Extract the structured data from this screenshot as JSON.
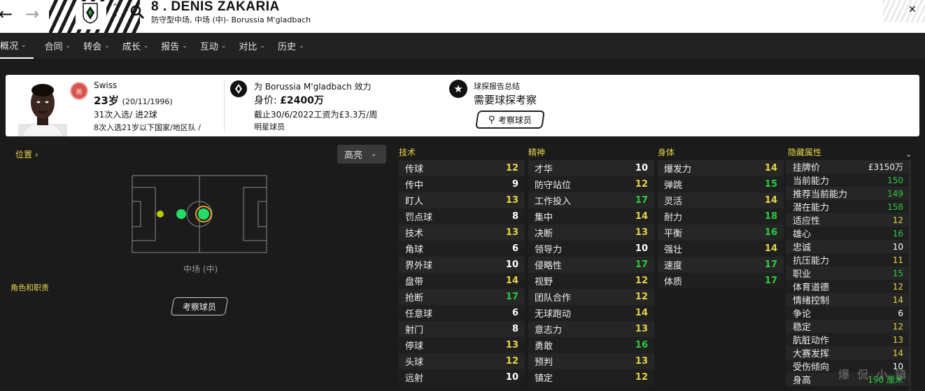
{
  "header": {
    "player_name": "8 . DENIS ZAKARIA",
    "player_sub": "防守型中场, 中场 (中)- Borussia M'gladbach"
  },
  "menu": [
    {
      "label": "概况"
    },
    {
      "label": "合同"
    },
    {
      "label": "转会"
    },
    {
      "label": "成长"
    },
    {
      "label": "报告"
    },
    {
      "label": "互动"
    },
    {
      "label": "对比"
    },
    {
      "label": "历史"
    }
  ],
  "card": {
    "flag_text": "国家...",
    "nationality": "Swiss",
    "age": "23岁",
    "dob": "(20/11/1996)",
    "caps": "31次入选/ 进2球",
    "youth_caps": "8次入选21岁以下国家/地区队 /",
    "club_line": "为 Borussia M'gladbach 效力",
    "value_label": "身价:",
    "value": "£2400万",
    "wage": "截止30/6/2022工资为£3.3万/周",
    "status": "明星球员",
    "report_title": "球探报告总结",
    "report_text": "需要球探考察",
    "scout_button": "考察球员"
  },
  "left": {
    "position_link": "位置",
    "highlight": "高亮",
    "position_label": "中场 (中)",
    "roles_label": "角色和职责",
    "scout_button": "考察球员"
  },
  "colors": {
    "attr_high": "#2ecc40",
    "attr_mid": "#e8d34a",
    "attr_low": "#ffffff",
    "accent": "#e8d34a"
  },
  "technical": {
    "title": "技术",
    "rows": [
      {
        "name": "传球",
        "value": "12"
      },
      {
        "name": "传中",
        "value": "9"
      },
      {
        "name": "盯人",
        "value": "13"
      },
      {
        "name": "罚点球",
        "value": "8"
      },
      {
        "name": "技术",
        "value": "13"
      },
      {
        "name": "角球",
        "value": "6"
      },
      {
        "name": "界外球",
        "value": "10"
      },
      {
        "name": "盘带",
        "value": "14"
      },
      {
        "name": "抢断",
        "value": "17"
      },
      {
        "name": "任意球",
        "value": "6"
      },
      {
        "name": "射门",
        "value": "8"
      },
      {
        "name": "停球",
        "value": "13"
      },
      {
        "name": "头球",
        "value": "12"
      },
      {
        "name": "远射",
        "value": "10"
      }
    ]
  },
  "mental": {
    "title": "精神",
    "rows": [
      {
        "name": "才华",
        "value": "10"
      },
      {
        "name": "防守站位",
        "value": "12"
      },
      {
        "name": "工作投入",
        "value": "17"
      },
      {
        "name": "集中",
        "value": "14"
      },
      {
        "name": "决断",
        "value": "13"
      },
      {
        "name": "领导力",
        "value": "10"
      },
      {
        "name": "侵略性",
        "value": "17"
      },
      {
        "name": "视野",
        "value": "12"
      },
      {
        "name": "团队合作",
        "value": "12"
      },
      {
        "name": "无球跑动",
        "value": "14"
      },
      {
        "name": "意志力",
        "value": "13"
      },
      {
        "name": "勇敢",
        "value": "16"
      },
      {
        "name": "预判",
        "value": "13"
      },
      {
        "name": "镇定",
        "value": "12"
      }
    ]
  },
  "physical": {
    "title": "身体",
    "rows": [
      {
        "name": "爆发力",
        "value": "14"
      },
      {
        "name": "弹跳",
        "value": "15"
      },
      {
        "name": "灵活",
        "value": "14"
      },
      {
        "name": "耐力",
        "value": "18"
      },
      {
        "name": "平衡",
        "value": "16"
      },
      {
        "name": "强壮",
        "value": "14"
      },
      {
        "name": "速度",
        "value": "17"
      },
      {
        "name": "体质",
        "value": "17"
      }
    ]
  },
  "hidden": {
    "title": "隐藏属性",
    "rows": [
      {
        "name": "挂牌价",
        "value": "£3150万"
      },
      {
        "name": "当前能力",
        "value": "150"
      },
      {
        "name": "推荐当前能力",
        "value": "149"
      },
      {
        "name": "潜在能力",
        "value": "158"
      },
      {
        "name": "适应性",
        "value": "12"
      },
      {
        "name": "雄心",
        "value": "16"
      },
      {
        "name": "忠诚",
        "value": "10"
      },
      {
        "name": "抗压能力",
        "value": "11"
      },
      {
        "name": "职业",
        "value": "15"
      },
      {
        "name": "体育道德",
        "value": "12"
      },
      {
        "name": "情绪控制",
        "value": "14"
      },
      {
        "name": "争论",
        "value": "6"
      },
      {
        "name": "稳定",
        "value": "12"
      },
      {
        "name": "肮脏动作",
        "value": "13"
      },
      {
        "name": "大赛发挥",
        "value": "14"
      },
      {
        "name": "受伤倾向",
        "value": "10"
      },
      {
        "name": "身高",
        "value": "190 厘米"
      }
    ]
  },
  "watermark": "爆 侃 小 镇"
}
